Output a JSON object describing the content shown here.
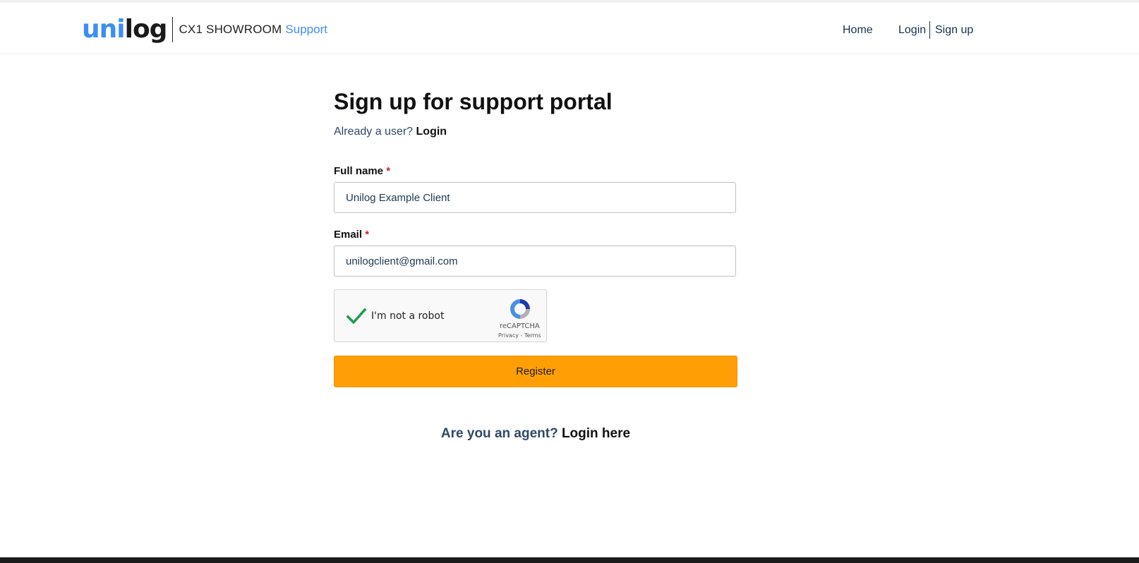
{
  "header": {
    "logo_uni": "uni",
    "logo_log": "log",
    "logo_sub": "CX1 SHOWROOM",
    "logo_support": "Support",
    "nav": {
      "home": "Home",
      "login": "Login",
      "signup": "Sign up"
    }
  },
  "form": {
    "title": "Sign up for support portal",
    "already_text": "Already a user?",
    "already_login": "Login",
    "full_name_label": "Full name",
    "full_name_value": "Unilog Example Client",
    "email_label": "Email",
    "email_value": "unilogclient@gmail.com",
    "required_mark": "*",
    "register_label": "Register"
  },
  "captcha": {
    "label": "I'm not a robot",
    "brand": "reCAPTCHA",
    "terms": "Privacy - Terms",
    "checked": true
  },
  "agent": {
    "prefix": "Are you an agent?",
    "link": "Login here"
  },
  "colors": {
    "accent_blue": "#3d8ef0",
    "button_orange": "#ff9f05",
    "check_green": "#1a9b4d"
  }
}
